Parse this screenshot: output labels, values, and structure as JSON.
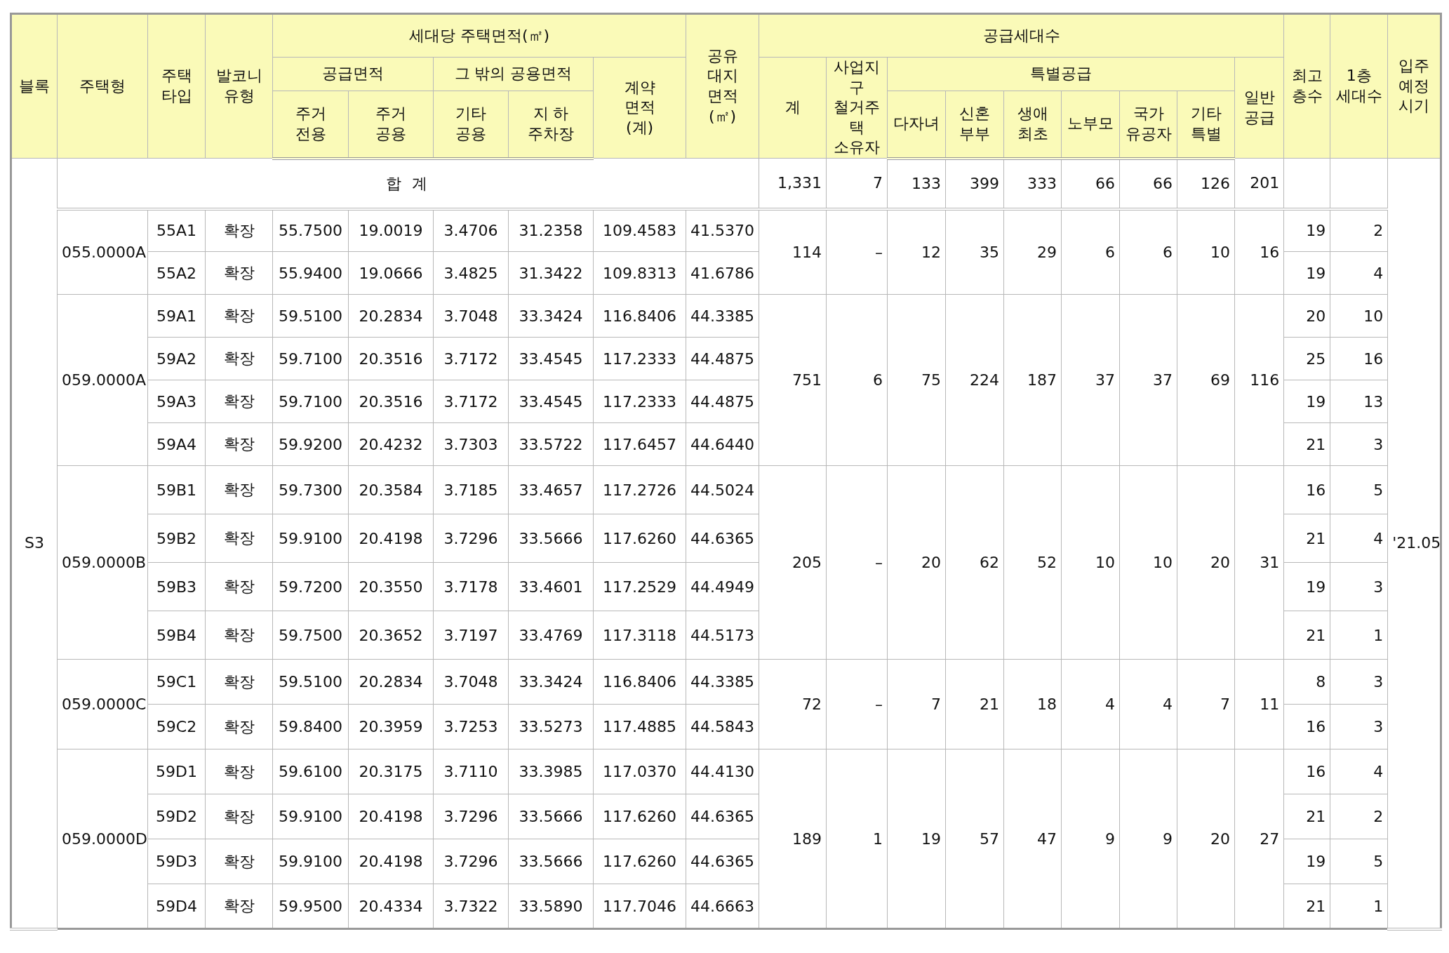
{
  "table": {
    "header_rows": [
      [
        "블록",
        "주택형",
        "주택\n타입",
        "발코니\n유형",
        "세대당 주택면적(㎡)",
        "공유\n대지\n면적\n(㎡)",
        "공급세대수",
        "최고\n층수",
        "1층\n세대수",
        "입주\n예정\n시기"
      ],
      [
        "공급면적",
        "그 밖의 공용면적",
        "계약\n면적\n(계)",
        "계",
        "사업지구\n철거주택\n소유자",
        "특별공급",
        "일반\n공급"
      ],
      [
        "주거\n전용",
        "주거\n공용",
        "기타\n공용",
        "지  하\n주차장",
        "다자녀",
        "신혼\n부부",
        "생애\n최초",
        "노부모",
        "국가\n유공자",
        "기타\n특별"
      ]
    ],
    "block": "S3",
    "move_in": "'21.05",
    "total": {
      "label": "합 계",
      "counts": [
        "1,331",
        "7",
        "133",
        "399",
        "333",
        "66",
        "66",
        "126",
        "201"
      ]
    },
    "groups": [
      {
        "house_type": "055.0000A",
        "counts": [
          "114",
          "–",
          "12",
          "35",
          "29",
          "6",
          "6",
          "10",
          "16"
        ],
        "units": [
          {
            "type": "55A1",
            "balcony": "확장",
            "areas": [
              "55.7500",
              "19.0019",
              "3.4706",
              "31.2358",
              "109.4583",
              "41.5370"
            ],
            "floors": "19",
            "first_floor": "2"
          },
          {
            "type": "55A2",
            "balcony": "확장",
            "areas": [
              "55.9400",
              "19.0666",
              "3.4825",
              "31.3422",
              "109.8313",
              "41.6786"
            ],
            "floors": "19",
            "first_floor": "4"
          }
        ]
      },
      {
        "house_type": "059.0000A",
        "counts": [
          "751",
          "6",
          "75",
          "224",
          "187",
          "37",
          "37",
          "69",
          "116"
        ],
        "units": [
          {
            "type": "59A1",
            "balcony": "확장",
            "areas": [
              "59.5100",
              "20.2834",
              "3.7048",
              "33.3424",
              "116.8406",
              "44.3385"
            ],
            "floors": "20",
            "first_floor": "10"
          },
          {
            "type": "59A2",
            "balcony": "확장",
            "areas": [
              "59.7100",
              "20.3516",
              "3.7172",
              "33.4545",
              "117.2333",
              "44.4875"
            ],
            "floors": "25",
            "first_floor": "16"
          },
          {
            "type": "59A3",
            "balcony": "확장",
            "areas": [
              "59.7100",
              "20.3516",
              "3.7172",
              "33.4545",
              "117.2333",
              "44.4875"
            ],
            "floors": "19",
            "first_floor": "13"
          },
          {
            "type": "59A4",
            "balcony": "확장",
            "areas": [
              "59.9200",
              "20.4232",
              "3.7303",
              "33.5722",
              "117.6457",
              "44.6440"
            ],
            "floors": "21",
            "first_floor": "3"
          }
        ]
      },
      {
        "house_type": "059.0000B",
        "counts": [
          "205",
          "–",
          "20",
          "62",
          "52",
          "10",
          "10",
          "20",
          "31"
        ],
        "units": [
          {
            "type": "59B1",
            "balcony": "확장",
            "areas": [
              "59.7300",
              "20.3584",
              "3.7185",
              "33.4657",
              "117.2726",
              "44.5024"
            ],
            "floors": "16",
            "first_floor": "5"
          },
          {
            "type": "59B2",
            "balcony": "확장",
            "areas": [
              "59.9100",
              "20.4198",
              "3.7296",
              "33.5666",
              "117.6260",
              "44.6365"
            ],
            "floors": "21",
            "first_floor": "4"
          },
          {
            "type": "59B3",
            "balcony": "확장",
            "areas": [
              "59.7200",
              "20.3550",
              "3.7178",
              "33.4601",
              "117.2529",
              "44.4949"
            ],
            "floors": "19",
            "first_floor": "3"
          },
          {
            "type": "59B4",
            "balcony": "확장",
            "areas": [
              "59.7500",
              "20.3652",
              "3.7197",
              "33.4769",
              "117.3118",
              "44.5173"
            ],
            "floors": "21",
            "first_floor": "1"
          }
        ]
      },
      {
        "house_type": "059.0000C",
        "counts": [
          "72",
          "–",
          "7",
          "21",
          "18",
          "4",
          "4",
          "7",
          "11"
        ],
        "units": [
          {
            "type": "59C1",
            "balcony": "확장",
            "areas": [
              "59.5100",
              "20.2834",
              "3.7048",
              "33.3424",
              "116.8406",
              "44.3385"
            ],
            "floors": "8",
            "first_floor": "3"
          },
          {
            "type": "59C2",
            "balcony": "확장",
            "areas": [
              "59.8400",
              "20.3959",
              "3.7253",
              "33.5273",
              "117.4885",
              "44.5843"
            ],
            "floors": "16",
            "first_floor": "3"
          }
        ]
      },
      {
        "house_type": "059.0000D",
        "counts": [
          "189",
          "1",
          "19",
          "57",
          "47",
          "9",
          "9",
          "20",
          "27"
        ],
        "units": [
          {
            "type": "59D1",
            "balcony": "확장",
            "areas": [
              "59.6100",
              "20.3175",
              "3.7110",
              "33.3985",
              "117.0370",
              "44.4130"
            ],
            "floors": "16",
            "first_floor": "4"
          },
          {
            "type": "59D2",
            "balcony": "확장",
            "areas": [
              "59.9100",
              "20.4198",
              "3.7296",
              "33.5666",
              "117.6260",
              "44.6365"
            ],
            "floors": "21",
            "first_floor": "2"
          },
          {
            "type": "59D3",
            "balcony": "확장",
            "areas": [
              "59.9100",
              "20.4198",
              "3.7296",
              "33.5666",
              "117.6260",
              "44.6365"
            ],
            "floors": "19",
            "first_floor": "5"
          },
          {
            "type": "59D4",
            "balcony": "확장",
            "areas": [
              "59.9500",
              "20.4334",
              "3.7322",
              "33.5890",
              "117.7046",
              "44.6663"
            ],
            "floors": "21",
            "first_floor": "1"
          }
        ]
      }
    ]
  }
}
